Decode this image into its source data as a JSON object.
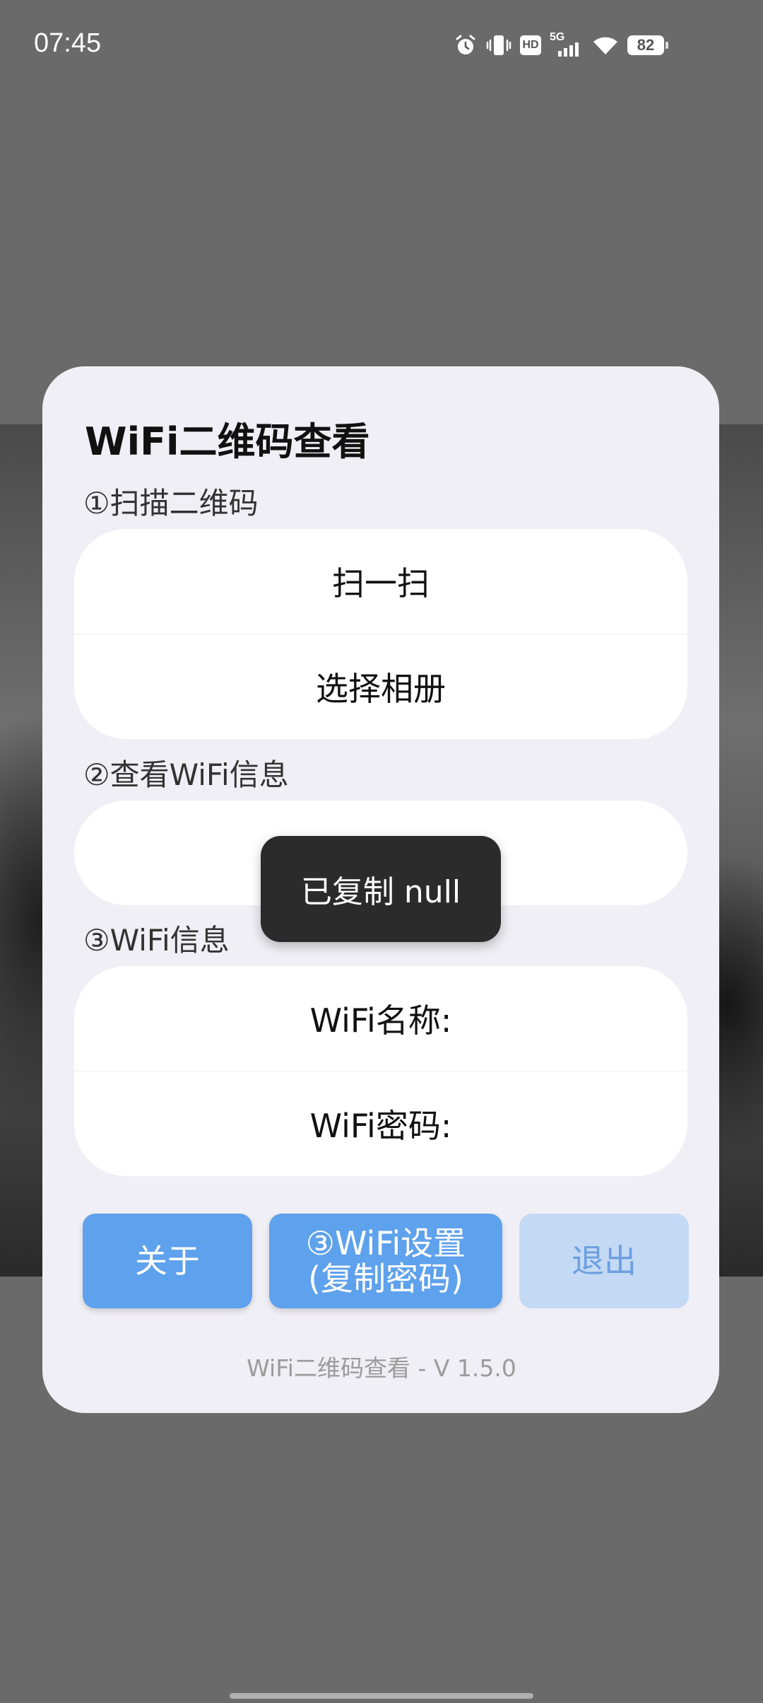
{
  "status_bar": {
    "time": "07:45",
    "network": "5G",
    "hd_label": "HD",
    "battery": "82",
    "icons": [
      "alarm-icon",
      "vibrate-icon",
      "hd-icon",
      "signal-5g-icon",
      "wifi-icon",
      "battery-icon"
    ]
  },
  "dialog": {
    "title": "WiFi二维码查看",
    "scan_section": {
      "label": "①扫描二维码",
      "scan_button": "扫一扫",
      "album_button": "选择相册"
    },
    "view_section": {
      "label": "②查看WiFi信息",
      "field_value": ""
    },
    "info_section": {
      "label": "③WiFi信息",
      "name_label": "WiFi名称:",
      "password_label": "WiFi密码:"
    },
    "buttons": {
      "about": "关于",
      "wifi_settings_line1": "③WiFi设置",
      "wifi_settings_line2": "(复制密码)",
      "exit": "退出"
    },
    "footer": "WiFi二维码查看 - V 1.5.0"
  },
  "toast": {
    "text": "已复制 null"
  },
  "colors": {
    "primary_button": "#5ea1ec",
    "disabled_button": "#c4d9f4",
    "dialog_bg": "#f0eff5",
    "toast_bg": "#2b2b2b",
    "scrim": "#6a6a6a"
  }
}
